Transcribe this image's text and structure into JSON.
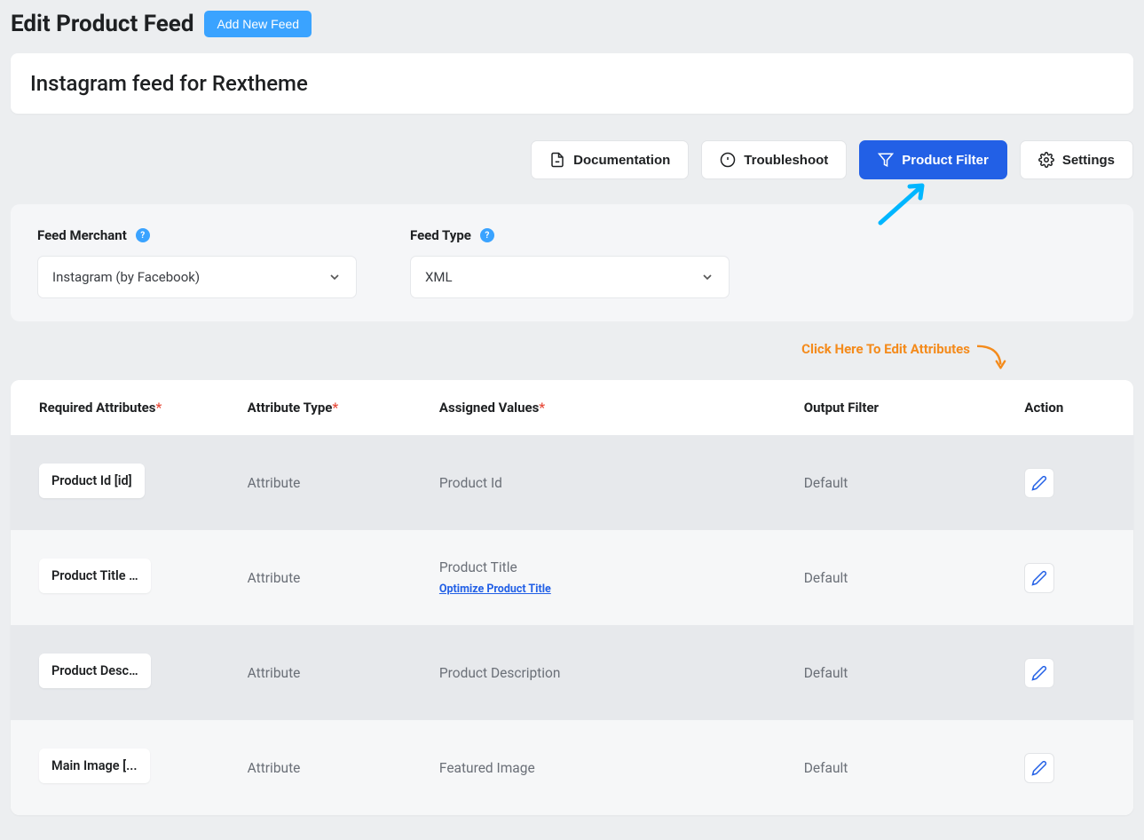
{
  "header": {
    "page_title": "Edit Product Feed",
    "add_new_label": "Add New Feed"
  },
  "feed_name": "Instagram feed for Rextheme",
  "toolbar": {
    "documentation": "Documentation",
    "troubleshoot": "Troubleshoot",
    "product_filter": "Product Filter",
    "settings": "Settings"
  },
  "config": {
    "merchant_label": "Feed Merchant",
    "merchant_value": "Instagram (by Facebook)",
    "type_label": "Feed Type",
    "type_value": "XML"
  },
  "hint": "Click Here To Edit Attributes",
  "table": {
    "headers": {
      "required": "Required Attributes",
      "type": "Attribute Type",
      "values": "Assigned Values",
      "filter": "Output Filter",
      "action": "Action"
    },
    "rows": [
      {
        "req": "Product Id [id]",
        "type": "Attribute",
        "value": "Product Id",
        "optimize": "",
        "filter": "Default"
      },
      {
        "req": "Product Title …",
        "type": "Attribute",
        "value": "Product Title",
        "optimize": "Optimize Product Title",
        "filter": "Default"
      },
      {
        "req": "Product Desc…",
        "type": "Attribute",
        "value": "Product Description",
        "optimize": "",
        "filter": "Default"
      },
      {
        "req": "Main Image [...",
        "type": "Attribute",
        "value": "Featured Image",
        "optimize": "",
        "filter": "Default"
      }
    ]
  }
}
